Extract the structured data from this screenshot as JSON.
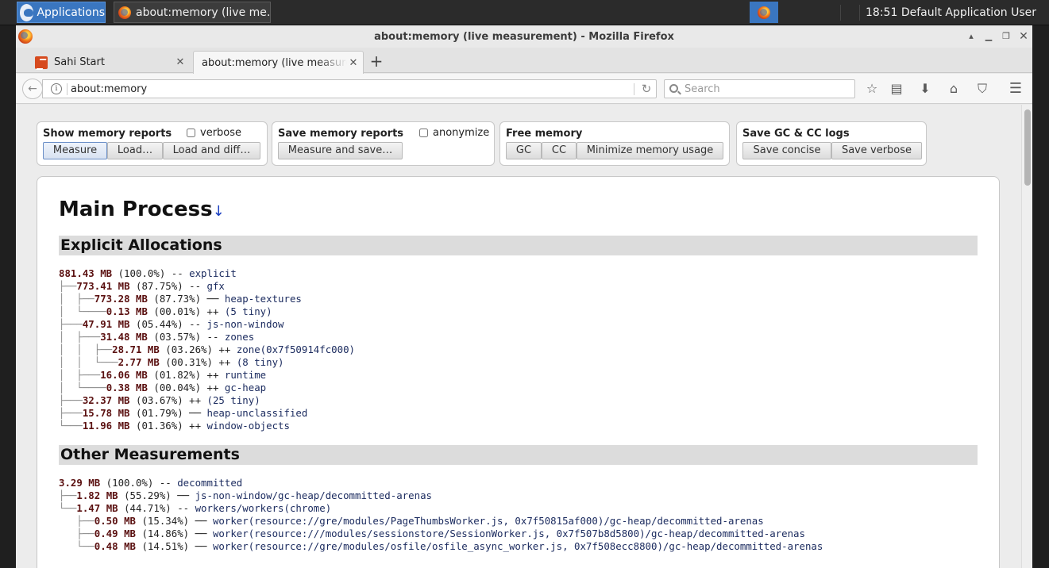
{
  "panel": {
    "apps_label": "Applications",
    "task_label": "about:memory (live me…",
    "clock": "18:51",
    "user": "Default Application User"
  },
  "window": {
    "title": "about:memory (live measurement) - Mozilla Firefox"
  },
  "tabs": [
    {
      "label": "Sahi Start"
    },
    {
      "label": "about:memory (live measurement)"
    }
  ],
  "navbar": {
    "url": "about:memory",
    "search_placeholder": "Search"
  },
  "controls": {
    "show": {
      "legend": "Show memory reports",
      "checkbox": "verbose",
      "buttons": [
        "Measure",
        "Load…",
        "Load and diff…"
      ]
    },
    "save": {
      "legend": "Save memory reports",
      "checkbox": "anonymize",
      "buttons": [
        "Measure and save…"
      ]
    },
    "free": {
      "legend": "Free memory",
      "buttons": [
        "GC",
        "CC",
        "Minimize memory usage"
      ]
    },
    "gc": {
      "legend": "Save GC & CC logs",
      "buttons": [
        "Save concise",
        "Save verbose"
      ]
    }
  },
  "report": {
    "process_title": "Main Process",
    "process_arrow": "↓",
    "explicit_heading": "Explicit Allocations",
    "other_heading": "Other Measurements",
    "explicit_tree": [
      {
        "prefix": "",
        "amount": "881.43 MB",
        "rest": " (100.0%) -- ",
        "name": "explicit"
      },
      {
        "prefix": "├──",
        "amount": "773.41 MB",
        "rest": " (87.75%) -- ",
        "name": "gfx"
      },
      {
        "prefix": "│  ├──",
        "amount": "773.28 MB",
        "rest": " (87.73%) ── ",
        "name": "heap-textures"
      },
      {
        "prefix": "│  └────",
        "amount": "0.13 MB",
        "rest": " (00.01%) ++ ",
        "name": "(5 tiny)"
      },
      {
        "prefix": "├───",
        "amount": "47.91 MB",
        "rest": " (05.44%) -- ",
        "name": "js-non-window"
      },
      {
        "prefix": "│  ├───",
        "amount": "31.48 MB",
        "rest": " (03.57%) -- ",
        "name": "zones"
      },
      {
        "prefix": "│  │  ├──",
        "amount": "28.71 MB",
        "rest": " (03.26%) ++ ",
        "name": "zone(0x7f50914fc000)"
      },
      {
        "prefix": "│  │  └───",
        "amount": "2.77 MB",
        "rest": " (00.31%) ++ ",
        "name": "(8 tiny)"
      },
      {
        "prefix": "│  ├───",
        "amount": "16.06 MB",
        "rest": " (01.82%) ++ ",
        "name": "runtime"
      },
      {
        "prefix": "│  └────",
        "amount": "0.38 MB",
        "rest": " (00.04%) ++ ",
        "name": "gc-heap"
      },
      {
        "prefix": "├───",
        "amount": "32.37 MB",
        "rest": " (03.67%) ++ ",
        "name": "(25 tiny)"
      },
      {
        "prefix": "├───",
        "amount": "15.78 MB",
        "rest": " (01.79%) ── ",
        "name": "heap-unclassified"
      },
      {
        "prefix": "└───",
        "amount": "11.96 MB",
        "rest": " (01.36%) ++ ",
        "name": "window-objects"
      }
    ],
    "other_tree": [
      {
        "prefix": "",
        "amount": "3.29 MB",
        "rest": " (100.0%) -- ",
        "name": "decommitted"
      },
      {
        "prefix": "├──",
        "amount": "1.82 MB",
        "rest": " (55.29%) ── ",
        "name": "js-non-window/gc-heap/decommitted-arenas"
      },
      {
        "prefix": "└──",
        "amount": "1.47 MB",
        "rest": " (44.71%) -- ",
        "name": "workers/workers(chrome)"
      },
      {
        "prefix": "   ├──",
        "amount": "0.50 MB",
        "rest": " (15.34%) ── ",
        "name": "worker(resource://gre/modules/PageThumbsWorker.js, 0x7f50815af000)/gc-heap/decommitted-arenas"
      },
      {
        "prefix": "   ├──",
        "amount": "0.49 MB",
        "rest": " (14.86%) ── ",
        "name": "worker(resource:///modules/sessionstore/SessionWorker.js, 0x7f507b8d5800)/gc-heap/decommitted-arenas"
      },
      {
        "prefix": "   └──",
        "amount": "0.48 MB",
        "rest": " (14.51%) ── ",
        "name": "worker(resource://gre/modules/osfile/osfile_async_worker.js, 0x7f508ecc8800)/gc-heap/decommitted-arenas"
      }
    ]
  }
}
